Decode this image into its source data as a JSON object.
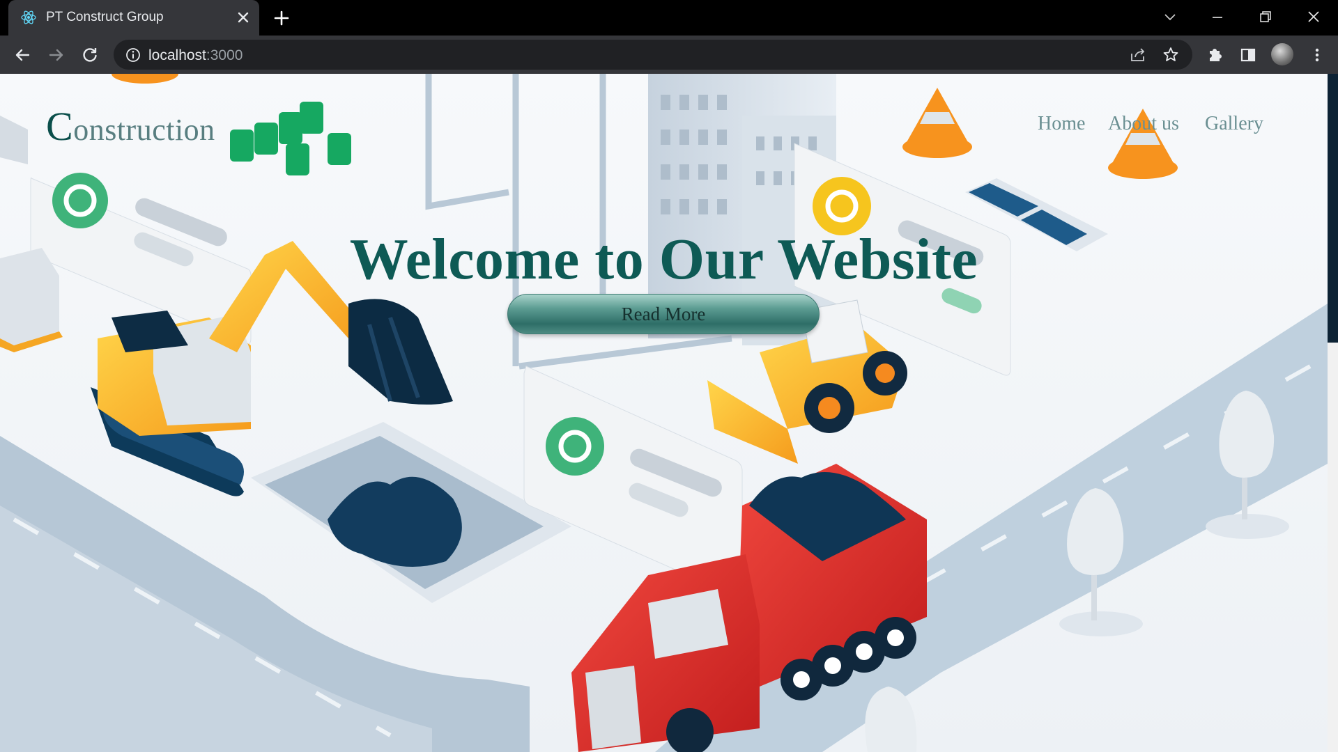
{
  "browser": {
    "tab_title": "PT Construct Group",
    "url_host": "localhost",
    "url_port": ":3000"
  },
  "site": {
    "logo_initial": "C",
    "logo_rest": "onstruction",
    "nav": [
      "Home",
      "About us",
      "Gallery"
    ],
    "hero_title": "Welcome to Our Website",
    "cta_label": "Read More"
  },
  "colors": {
    "brand": "#0b4f4b",
    "nav_text": "#6a8f92",
    "cta_gradient_mid": "#2e6e67",
    "truck_red": "#e53935",
    "excavator_yellow": "#f9b32f"
  }
}
